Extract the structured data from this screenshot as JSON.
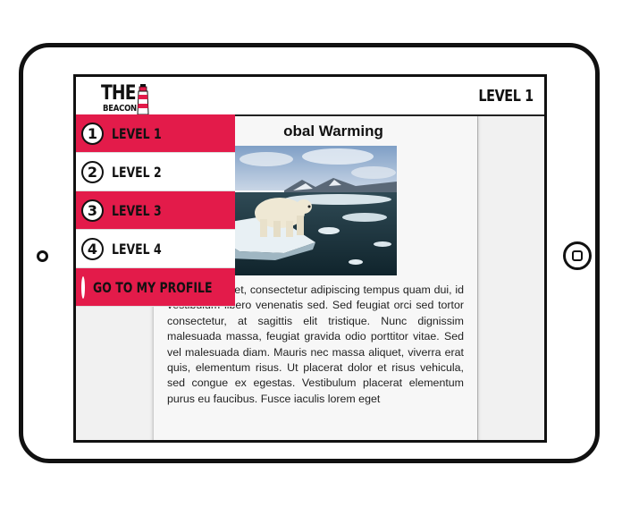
{
  "app": {
    "logo_line1": "THE",
    "logo_line2": "BEACON",
    "current_level": "LEVEL 1"
  },
  "menu": {
    "items": [
      {
        "number": "1",
        "label": "LEVEL 1",
        "active": true
      },
      {
        "number": "2",
        "label": "LEVEL 2",
        "active": false
      },
      {
        "number": "3",
        "label": "LEVEL 3",
        "active": false
      },
      {
        "number": "4",
        "label": "LEVEL 4",
        "active": false
      }
    ],
    "profile_label": "GO TO MY PROFILE"
  },
  "article": {
    "title": "obal Warming",
    "body": "n dolor sit amet, consectetur adipiscing tempus quam dui, id vestibulum libero venenatis sed. Sed feugiat orci sed tortor consectetur, at sagittis elit tristique. Nunc dignissim malesuada massa, feugiat gravida odio porttitor vitae. Sed vel malesuada diam. Mauris nec massa aliquet, viverra erat quis, elementum risus. Ut placerat dolor et risus vehicula, sed congue ex egestas. Vestibulum placerat elementum purus eu faucibus. Fusce iaculis lorem eget"
  },
  "colors": {
    "accent": "#e31b4a",
    "frame": "#111111"
  }
}
